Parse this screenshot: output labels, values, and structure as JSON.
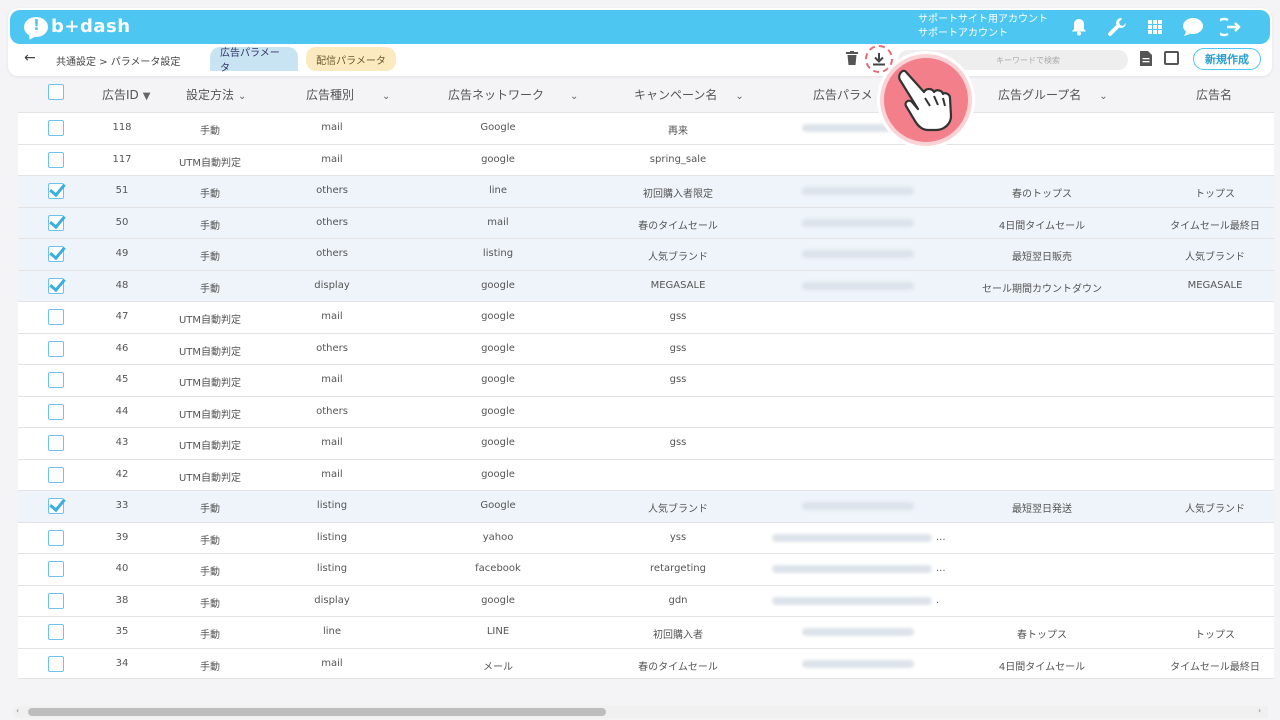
{
  "app": {
    "logo": "b+dash"
  },
  "account": {
    "line1": "サポートサイト用アカウント",
    "line2": "サポートアカウント"
  },
  "icons": {
    "bell": "bell-icon",
    "wrench": "wrench-icon",
    "apps": "apps-grid-icon",
    "chat": "chat-icon",
    "logout": "logout-icon"
  },
  "breadcrumb": "共通設定 > パラメータ設定",
  "tabs": {
    "ad": "広告パラメータ",
    "delivery": "配信パラメータ"
  },
  "search": {
    "placeholder": "キーワードで検索"
  },
  "new_button": "新規作成",
  "columns": [
    "広告ID",
    "設定方法",
    "広告種別",
    "広告ネットワーク",
    "キャンペーン名",
    "広告パラメ",
    "広告グループ名",
    "広告名"
  ],
  "rows": [
    {
      "checked": false,
      "id": "118",
      "method": "手動",
      "type": "mail",
      "network": "Google",
      "campaign": "再来",
      "param": "blur",
      "group": "",
      "ad": ""
    },
    {
      "checked": false,
      "id": "117",
      "method": "UTM自動判定",
      "type": "mail",
      "network": "google",
      "campaign": "spring_sale",
      "param": "",
      "group": "",
      "ad": ""
    },
    {
      "checked": true,
      "id": "51",
      "method": "手動",
      "type": "others",
      "network": "line",
      "campaign": "初回購入者限定",
      "param": "blur",
      "group": "春のトップス",
      "ad": "トップス"
    },
    {
      "checked": true,
      "id": "50",
      "method": "手動",
      "type": "others",
      "network": "mail",
      "campaign": "春のタイムセール",
      "param": "blur",
      "group": "4日間タイムセール",
      "ad": "タイムセール最終日"
    },
    {
      "checked": true,
      "id": "49",
      "method": "手動",
      "type": "others",
      "network": "listing",
      "campaign": "人気ブランド",
      "param": "blur",
      "group": "最短翌日販売",
      "ad": "人気ブランド"
    },
    {
      "checked": true,
      "id": "48",
      "method": "手動",
      "type": "display",
      "network": "google",
      "campaign": "MEGASALE",
      "param": "blur",
      "group": "セール期間カウントダウン",
      "ad": "MEGASALE"
    },
    {
      "checked": false,
      "id": "47",
      "method": "UTM自動判定",
      "type": "mail",
      "network": "google",
      "campaign": "gss",
      "param": "",
      "group": "",
      "ad": ""
    },
    {
      "checked": false,
      "id": "46",
      "method": "UTM自動判定",
      "type": "others",
      "network": "google",
      "campaign": "gss",
      "param": "",
      "group": "",
      "ad": ""
    },
    {
      "checked": false,
      "id": "45",
      "method": "UTM自動判定",
      "type": "mail",
      "network": "google",
      "campaign": "gss",
      "param": "",
      "group": "",
      "ad": ""
    },
    {
      "checked": false,
      "id": "44",
      "method": "UTM自動判定",
      "type": "others",
      "network": "google",
      "campaign": "",
      "param": "",
      "group": "",
      "ad": ""
    },
    {
      "checked": false,
      "id": "43",
      "method": "UTM自動判定",
      "type": "mail",
      "network": "google",
      "campaign": "gss",
      "param": "",
      "group": "",
      "ad": ""
    },
    {
      "checked": false,
      "id": "42",
      "method": "UTM自動判定",
      "type": "mail",
      "network": "google",
      "campaign": "",
      "param": "",
      "group": "",
      "ad": ""
    },
    {
      "checked": true,
      "id": "33",
      "method": "手動",
      "type": "listing",
      "network": "Google",
      "campaign": "人気ブランド",
      "param": "blur",
      "group": "最短翌日発送",
      "ad": "人気ブランド"
    },
    {
      "checked": false,
      "id": "39",
      "method": "手動",
      "type": "listing",
      "network": "yahoo",
      "campaign": "yss",
      "param": "blur-long",
      "suffix": "...",
      "group": "",
      "ad": ""
    },
    {
      "checked": false,
      "id": "40",
      "method": "手動",
      "type": "listing",
      "network": "facebook",
      "campaign": "retargeting",
      "param": "blur-long",
      "suffix": "...",
      "group": "",
      "ad": ""
    },
    {
      "checked": false,
      "id": "38",
      "method": "手動",
      "type": "display",
      "network": "google",
      "campaign": "gdn",
      "param": "blur-long",
      "suffix": ".",
      "group": "",
      "ad": ""
    },
    {
      "checked": false,
      "id": "35",
      "method": "手動",
      "type": "line",
      "network": "LINE",
      "campaign": "初回購入者",
      "param": "blur",
      "group": "春トップス",
      "ad": "トップス"
    },
    {
      "checked": false,
      "id": "34",
      "method": "手動",
      "type": "mail",
      "network": "メール",
      "campaign": "春のタイムセール",
      "param": "blur",
      "group": "4日間タイムセール",
      "ad": "タイムセール最終日"
    }
  ],
  "colors": {
    "brand": "#4dc7f2",
    "pointer": "#f37f8a",
    "selected_row": "#eef4fa"
  }
}
